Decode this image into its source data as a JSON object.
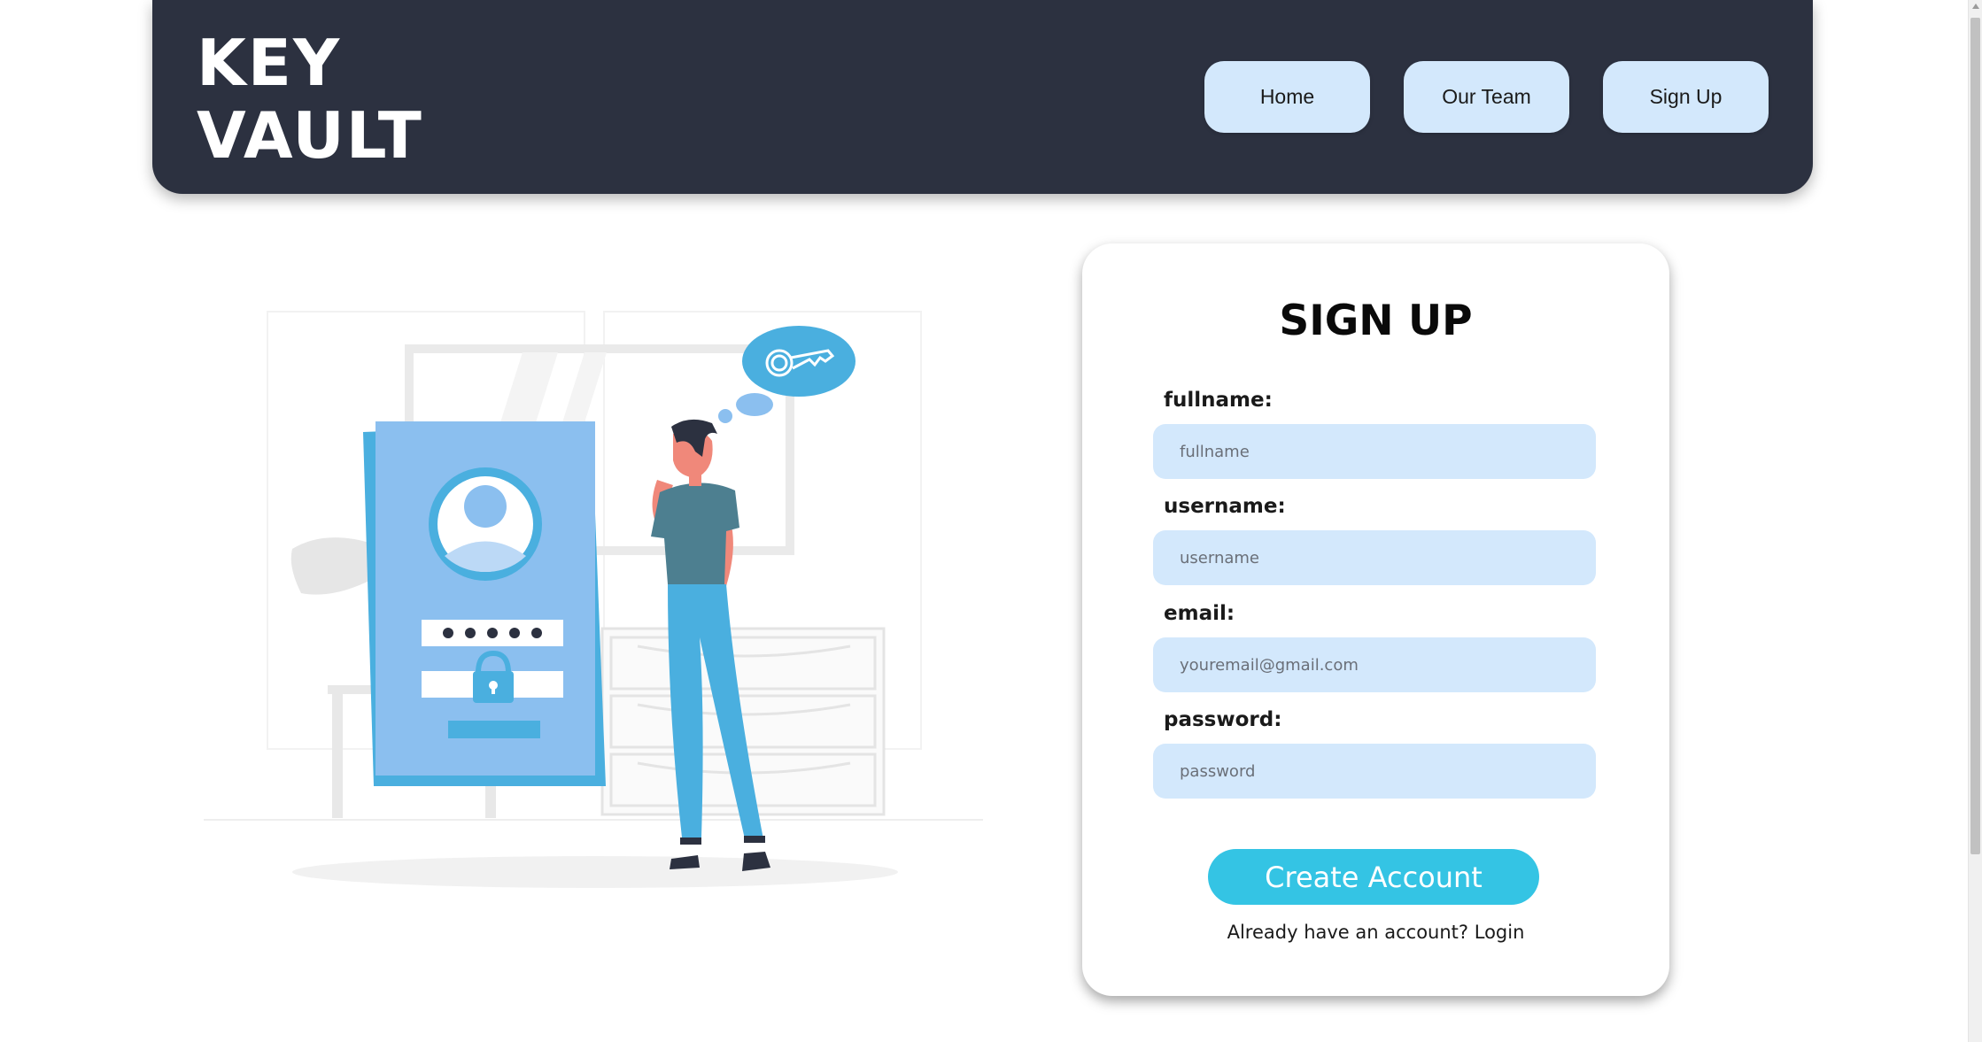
{
  "header": {
    "logo_line1": "KEY",
    "logo_line2": "VAULT",
    "nav": [
      "Home",
      "Our Team",
      "Sign Up"
    ]
  },
  "form": {
    "title": "SIGN UP",
    "fields": [
      {
        "label": "fullname:",
        "placeholder": "fullname"
      },
      {
        "label": "username:",
        "placeholder": "username"
      },
      {
        "label": "email:",
        "placeholder": "youremail@gmail.com"
      },
      {
        "label": "password:",
        "placeholder": "password"
      }
    ],
    "submit_label": "Create Account",
    "login_prompt": "Already have an account?",
    "login_link": "Login"
  },
  "colors": {
    "header_bg": "#2c3140",
    "nav_button_bg": "#d3e8fc",
    "input_bg": "#d3e8fc",
    "submit_bg": "#34c4e4",
    "illustration_blue": "#4aafdf",
    "illustration_light_blue": "#8bbfef"
  }
}
